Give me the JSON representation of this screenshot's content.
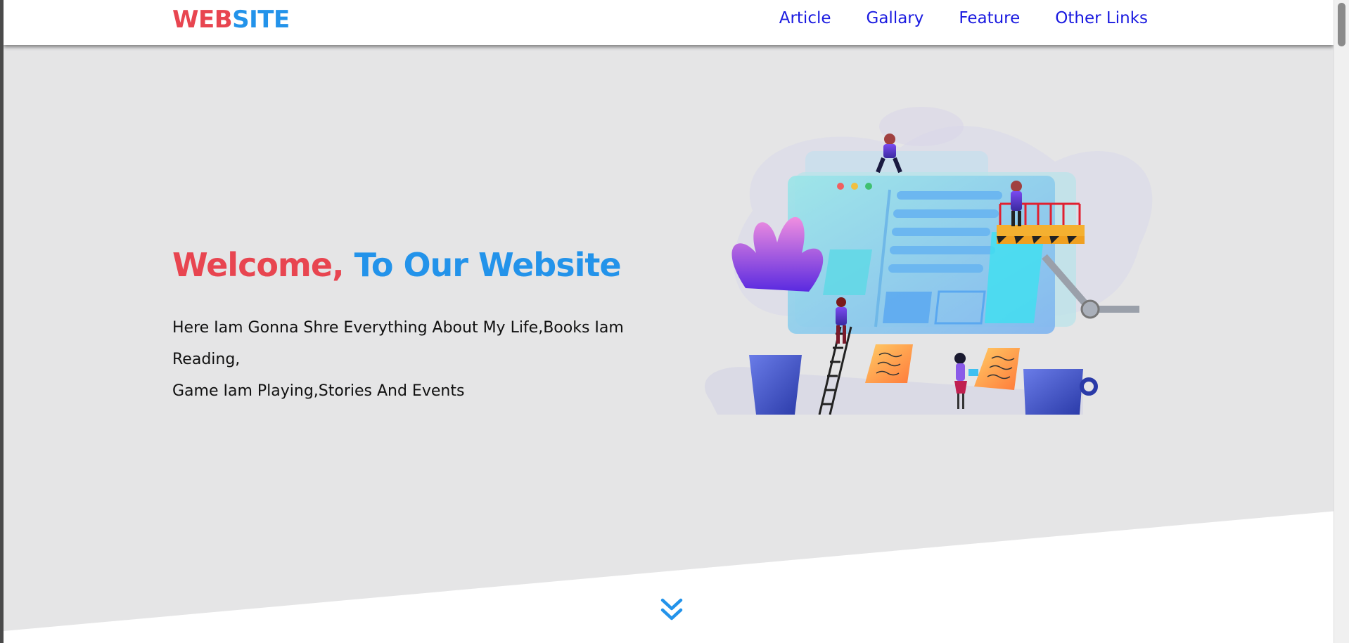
{
  "header": {
    "logo_part1": "WEB",
    "logo_part2": "SITE",
    "nav": [
      "Article",
      "Gallary",
      "Feature",
      "Other Links"
    ]
  },
  "hero": {
    "title_part1": "Welcome,",
    "title_part2": "To Our Website",
    "description_line1": "Here Iam Gonna Shre Everything About My Life,Books Iam Reading,",
    "description_line2": "Game Iam Playing,Stories And Events"
  },
  "icons": {
    "scroll_down": "double-chevron-down-icon"
  },
  "colors": {
    "accent_red": "#e84550",
    "accent_blue": "#2393ea",
    "nav_link": "#1a1ae0",
    "hero_bg": "#e5e5e6"
  }
}
